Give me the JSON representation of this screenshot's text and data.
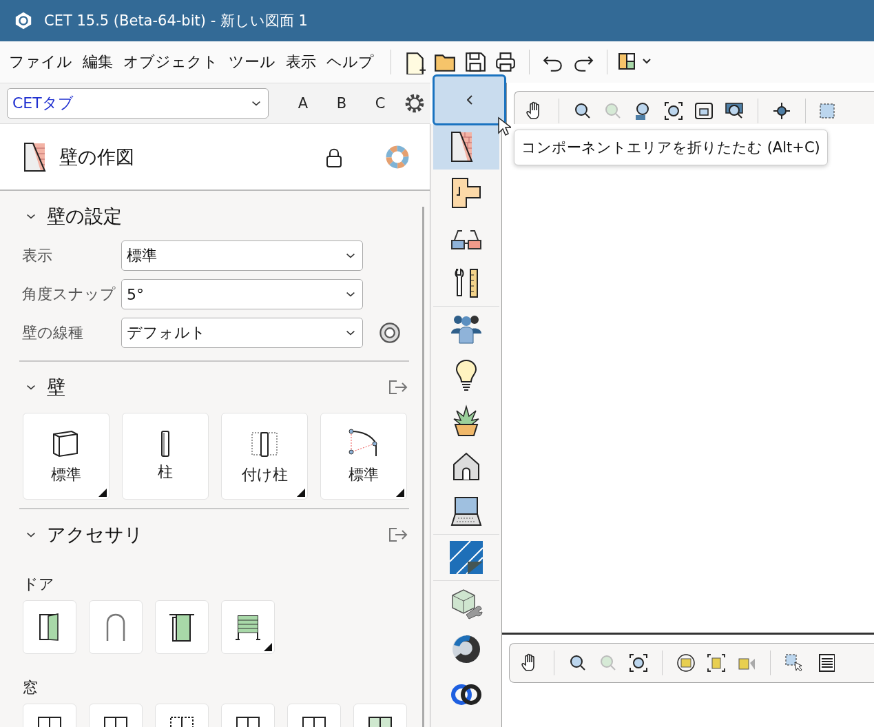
{
  "window": {
    "title": "CET 15.5 (Beta-64-bit) - 新しい図面 1"
  },
  "menu": {
    "items": [
      "ファイル",
      "編集",
      "オブジェクト",
      "ツール",
      "表示",
      "ヘルプ"
    ]
  },
  "tab_selector": {
    "value": "CETタブ"
  },
  "tab_buttons": [
    "A",
    "B",
    "C"
  ],
  "collapse_button": {
    "selected": true
  },
  "panel": {
    "title": "壁の作図",
    "sections": [
      {
        "kind": "fields",
        "title": "壁の設定",
        "expanded": true,
        "fields": [
          {
            "label": "表示",
            "value": "標準"
          },
          {
            "label": "角度スナップ",
            "value": "5°"
          },
          {
            "label": "壁の線種",
            "value": "デフォルト"
          }
        ]
      },
      {
        "kind": "tiles",
        "title": "壁",
        "expanded": true,
        "tiles": [
          {
            "label": "標準",
            "has_submenu": true
          },
          {
            "label": "柱",
            "has_submenu": false
          },
          {
            "label": "付け柱",
            "has_submenu": true
          },
          {
            "label": "標準",
            "has_submenu": true
          }
        ]
      },
      {
        "kind": "groups",
        "title": "アクセサリ",
        "expanded": true,
        "groups": [
          {
            "title": "ドア",
            "tiles": [
              {
                "has_submenu": false
              },
              {
                "has_submenu": false
              },
              {
                "has_submenu": false
              },
              {
                "has_submenu": true
              }
            ]
          },
          {
            "title": "窓",
            "tiles": [
              {
                "has_submenu": false
              },
              {
                "has_submenu": false
              },
              {
                "has_submenu": false
              },
              {
                "has_submenu": false
              },
              {
                "has_submenu": false
              },
              {
                "has_submenu": false
              }
            ]
          }
        ]
      }
    ]
  },
  "category_bar": {
    "items": [
      {
        "selected": true
      },
      {
        "selected": false
      },
      {
        "selected": false
      },
      {
        "selected": false
      },
      {
        "selected": false
      },
      {
        "selected": false
      },
      {
        "selected": false
      },
      {
        "selected": false
      },
      {
        "selected": false
      },
      {
        "selected": false
      },
      {
        "selected": false
      },
      {
        "selected": false
      },
      {
        "selected": false
      }
    ]
  },
  "tooltip": {
    "text": "コンポーネントエリアを折りたたむ (Alt+C)"
  }
}
